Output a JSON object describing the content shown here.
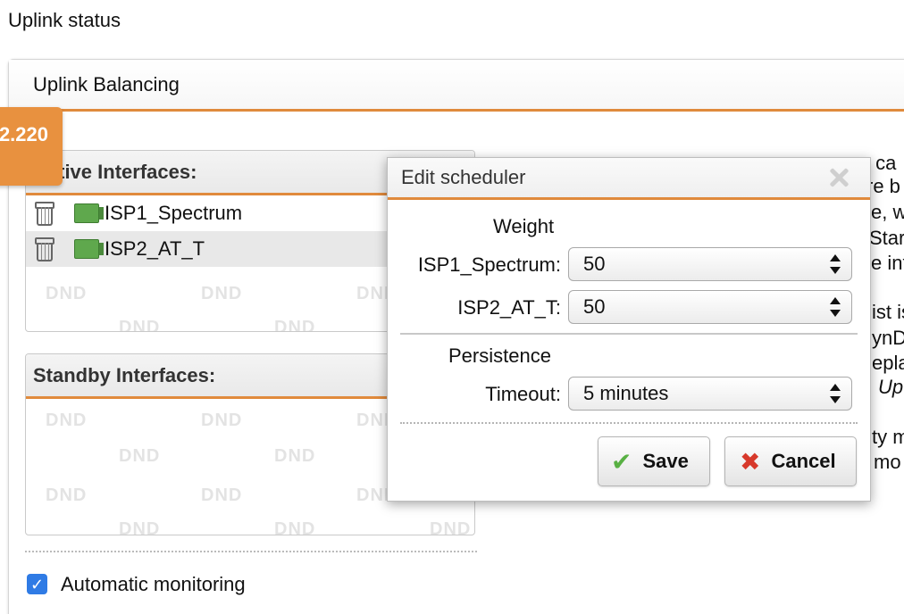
{
  "page": {
    "title": "Uplink status"
  },
  "panel": {
    "title": "Uplink Balancing",
    "ip_badge": "2.220"
  },
  "active": {
    "header": "Active Interfaces:",
    "items": [
      {
        "label": "ISP1_Spectrum"
      },
      {
        "label": "ISP2_AT_T"
      }
    ],
    "dnd": "DND"
  },
  "standby": {
    "header": "Standby Interfaces:",
    "dnd": "DND"
  },
  "monitoring": {
    "label": "Automatic monitoring",
    "checked": true
  },
  "help_fragments": [
    "s ca",
    "re b",
    "e, w",
    "Star",
    "e int",
    "ist is",
    "ynD",
    "epla",
    "Up",
    "ty m",
    "mo"
  ],
  "dialog": {
    "title": "Edit scheduler",
    "weight_label": "Weight",
    "isp1_label": "ISP1_Spectrum:",
    "isp1_value": "50",
    "isp2_label": "ISP2_AT_T:",
    "isp2_value": "50",
    "persistence_label": "Persistence",
    "timeout_label": "Timeout:",
    "timeout_value": "5 minutes",
    "save_label": "Save",
    "cancel_label": "Cancel"
  },
  "colors": {
    "accent": "#e08a3c",
    "badge": "#e8913f",
    "checkbox": "#2f7be5",
    "save_check": "#58b043",
    "cancel_x": "#d7392b"
  }
}
